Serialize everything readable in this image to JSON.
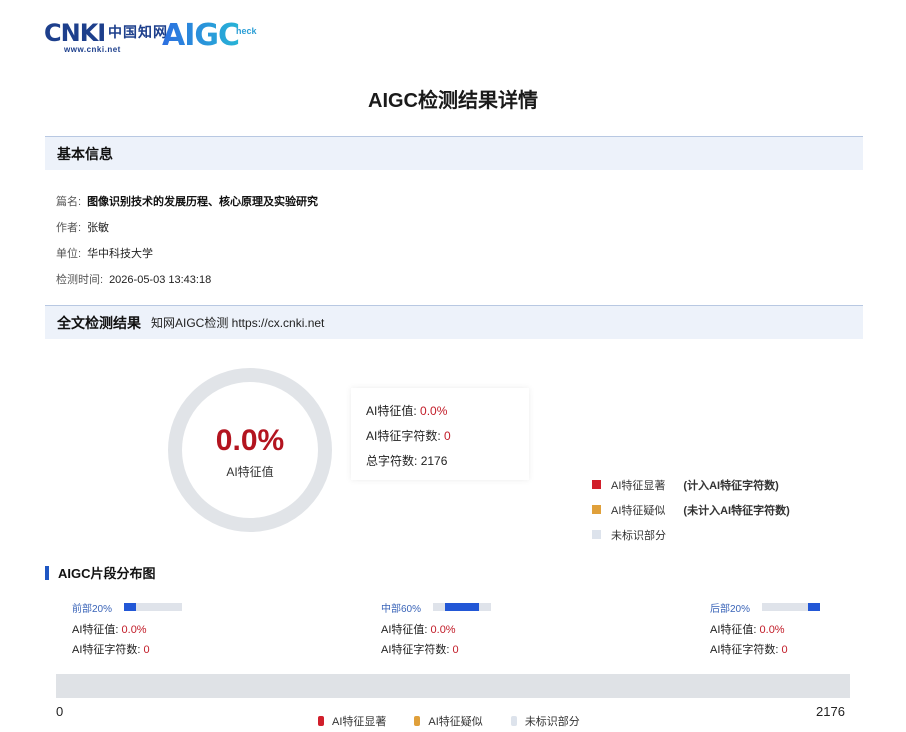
{
  "logo": {
    "cnki_text": "CNKI",
    "cnki_cn": "中国知网",
    "cnki_url": "www.cnki.net",
    "aigc_text": "AIGC",
    "aigc_check": "heck"
  },
  "report_title": "AIGC检测结果详情",
  "basic_info": {
    "header": "基本信息",
    "rows": [
      {
        "label": "篇名:",
        "value": "图像识别技术的发展历程、核心原理及实验研究"
      },
      {
        "label": "作者:",
        "value": "张敏"
      },
      {
        "label": "单位:",
        "value": "华中科技大学"
      },
      {
        "label": "检测时间:",
        "value": "2026-05-03 13:43:18"
      }
    ]
  },
  "full_result": {
    "header": "全文检测结果",
    "subtitle": "知网AIGC检测  https://cx.cnki.net",
    "ring_value": "0.0%",
    "ring_label": "AI特征值",
    "ai_value_fraction": 0.0,
    "stats": [
      {
        "label": "AI特征值:",
        "value": "0.0%"
      },
      {
        "label": "AI特征字符数:",
        "value": "0"
      },
      {
        "label": "总字符数:",
        "value": "2176"
      }
    ],
    "legend": [
      {
        "label": "AI特征显著",
        "note": "(计入AI特征字符数)",
        "color": "#d11f2b"
      },
      {
        "label": "AI特征疑似",
        "note": "(未计入AI特征字符数)",
        "color": "#e0a03a"
      },
      {
        "label": "未标识部分",
        "note": "",
        "color": "#dde3ec"
      }
    ]
  },
  "distribution": {
    "title": "AIGC片段分布图",
    "segments": [
      {
        "name": "前部20%",
        "ai_value_label": "AI特征值:",
        "ai_value": "0.0%",
        "ai_chars_label": "AI特征字符数:",
        "ai_chars": "0",
        "bar_start": 0.0,
        "bar_end": 0.2
      },
      {
        "name": "中部60%",
        "ai_value_label": "AI特征值:",
        "ai_value": "0.0%",
        "ai_chars_label": "AI特征字符数:",
        "ai_chars": "0",
        "bar_start": 0.2,
        "bar_end": 0.8
      },
      {
        "name": "后部20%",
        "ai_value_label": "AI特征值:",
        "ai_value": "0.0%",
        "ai_chars_label": "AI特征字符数:",
        "ai_chars": "0",
        "bar_start": 0.8,
        "bar_end": 1.0
      }
    ],
    "axis_start": "0",
    "axis_end": "2176",
    "legend": [
      {
        "label": "AI特征显著",
        "color": "#d11f2b"
      },
      {
        "label": "AI特征疑似",
        "color": "#e0a03a"
      },
      {
        "label": "未标识部分",
        "color": "#dde3ec"
      }
    ]
  }
}
